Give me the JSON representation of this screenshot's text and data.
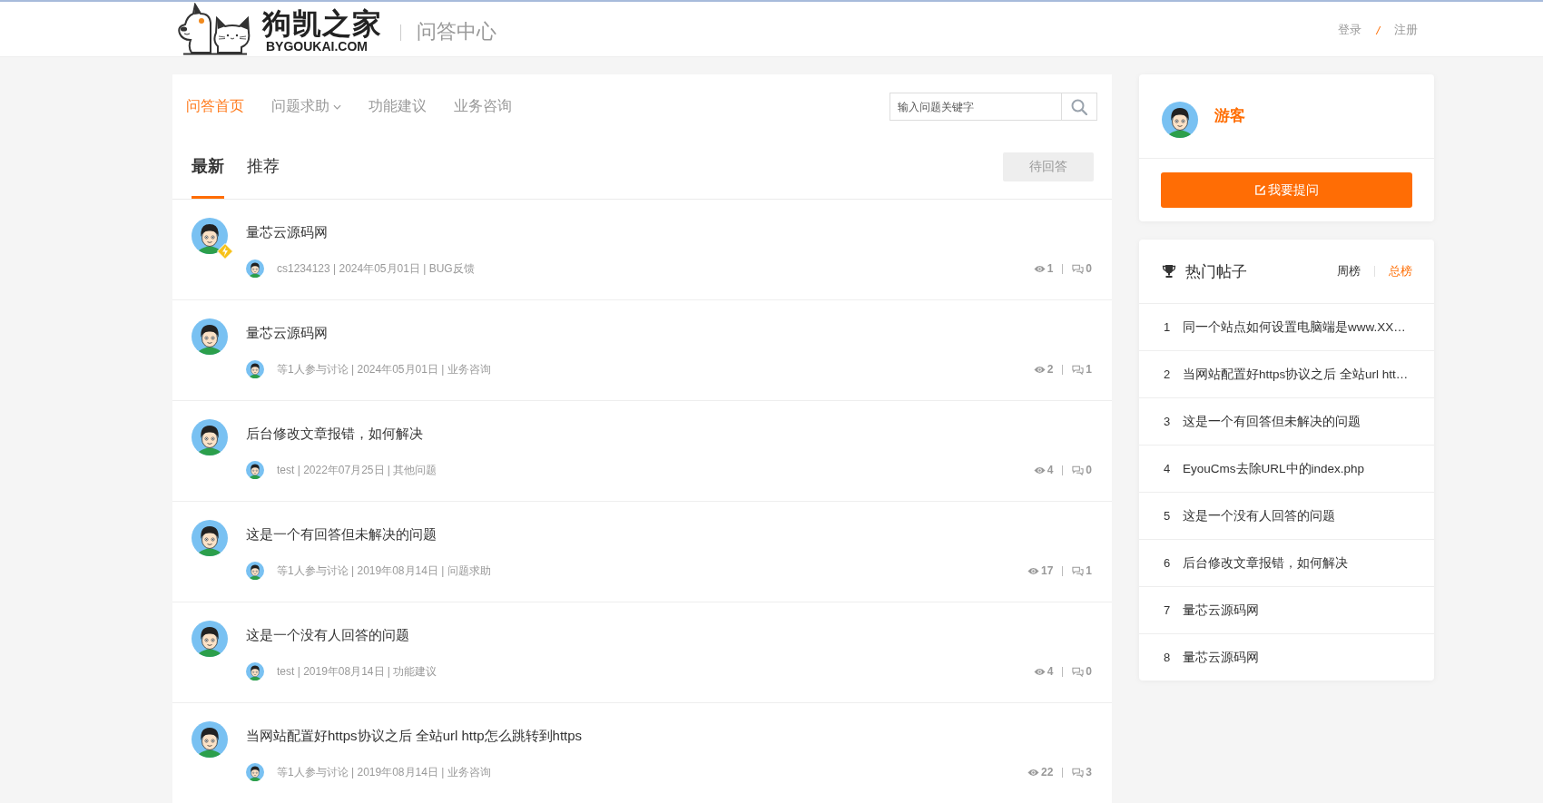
{
  "header": {
    "logo_title": "狗凯之家",
    "logo_domain": "BYGOUKAI.COM",
    "section_title": "问答中心",
    "auth_links": [
      {
        "label": "登录"
      },
      {
        "label": "注册"
      }
    ],
    "auth_separator": "/"
  },
  "nav": [
    {
      "label": "问答首页",
      "selected": true,
      "dropdown": false
    },
    {
      "label": "问题求助",
      "selected": false,
      "dropdown": true
    },
    {
      "label": "功能建议",
      "selected": false,
      "dropdown": false
    },
    {
      "label": "业务咨询",
      "selected": false,
      "dropdown": false
    }
  ],
  "search": {
    "placeholder": "输入问题关键字"
  },
  "tabs": [
    {
      "label": "最新",
      "selected": true
    },
    {
      "label": "推荐",
      "selected": false
    }
  ],
  "filter_button": "待回答",
  "questions": [
    {
      "title": "量芯云源码网",
      "badge": true,
      "meta": "cs1234123 | 2024年05月01日 | BUG反馈",
      "views": "1",
      "answers": "0"
    },
    {
      "title": "量芯云源码网",
      "badge": false,
      "meta": "等1人参与讨论 | 2024年05月01日 | 业务咨询",
      "views": "2",
      "answers": "1"
    },
    {
      "title": "后台修改文章报错，如何解决",
      "badge": false,
      "meta": "test | 2022年07月25日 | 其他问题",
      "views": "4",
      "answers": "0"
    },
    {
      "title": "这是一个有回答但未解决的问题",
      "badge": false,
      "meta": "等1人参与讨论 | 2019年08月14日 | 问题求助",
      "views": "17",
      "answers": "1"
    },
    {
      "title": "这是一个没有人回答的问题",
      "badge": false,
      "meta": "test | 2019年08月14日 | 功能建议",
      "views": "4",
      "answers": "0"
    },
    {
      "title": "当网站配置好https协议之后 全站url http怎么跳转到https",
      "badge": false,
      "meta": "等1人参与讨论 | 2019年08月14日 | 业务咨询",
      "views": "22",
      "answers": "3"
    }
  ],
  "sidebar": {
    "user_name": "游客",
    "ask_button": "我要提问",
    "hot": {
      "title": "热门帖子",
      "ranges": [
        {
          "label": "周榜",
          "selected": false
        },
        {
          "label": "总榜",
          "selected": true
        }
      ],
      "items": [
        {
          "rank": "1",
          "title": "同一个站点如何设置电脑端是www.XX…"
        },
        {
          "rank": "2",
          "title": "当网站配置好https协议之后 全站url htt…"
        },
        {
          "rank": "3",
          "title": "这是一个有回答但未解决的问题"
        },
        {
          "rank": "4",
          "title": "EyouCms去除URL中的index.php"
        },
        {
          "rank": "5",
          "title": "这是一个没有人回答的问题"
        },
        {
          "rank": "6",
          "title": "后台修改文章报错，如何解决"
        },
        {
          "rank": "7",
          "title": "量芯云源码网"
        },
        {
          "rank": "8",
          "title": "量芯云源码网"
        }
      ]
    }
  }
}
